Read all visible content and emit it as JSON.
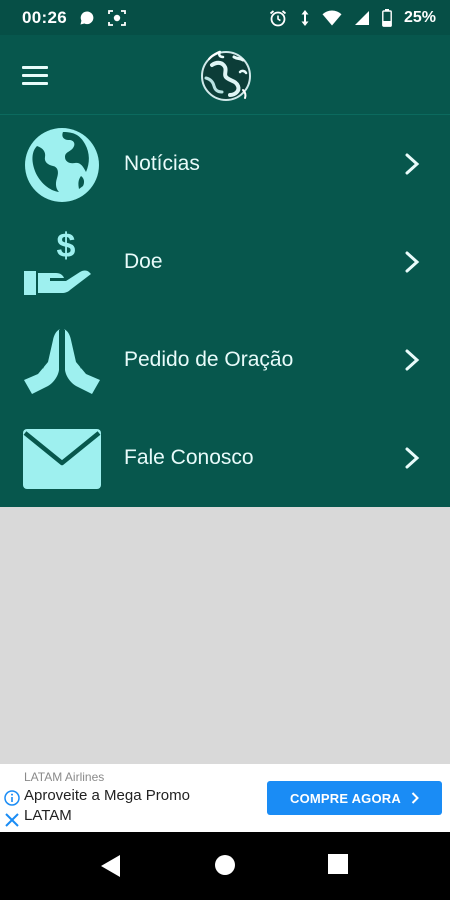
{
  "status_bar": {
    "time": "00:26",
    "battery_text": "25%",
    "icons": [
      "chat-bubble-icon",
      "screen-capture-icon",
      "alarm-icon",
      "data-arrows-icon",
      "wifi-icon",
      "cell-signal-icon",
      "battery-icon"
    ]
  },
  "app_bar": {
    "menu_icon": "hamburger-menu-icon",
    "logo_icon": "globe-logo-icon"
  },
  "menu": {
    "items": [
      {
        "label": "Notícias",
        "icon": "globe-icon"
      },
      {
        "label": "Doe",
        "icon": "donate-hand-icon"
      },
      {
        "label": "Pedido de Oração",
        "icon": "praying-hands-icon"
      },
      {
        "label": "Fale Conosco",
        "icon": "envelope-icon"
      }
    ],
    "chevron_icon": "chevron-right-icon"
  },
  "ad": {
    "advertiser": "LATAM Airlines",
    "headline": "Aproveite a Mega Promo LATAM",
    "cta_label": "COMPRE AGORA"
  },
  "nav_bar": {
    "buttons": [
      "back-icon",
      "home-icon",
      "recents-icon"
    ]
  },
  "colors": {
    "primary": "#07574d",
    "status_bar": "#064f46",
    "icon_tint": "#9ef0ef",
    "label": "#e8fbfa",
    "content_bg": "#d9d9d9",
    "ad_button": "#1a8cf5"
  }
}
